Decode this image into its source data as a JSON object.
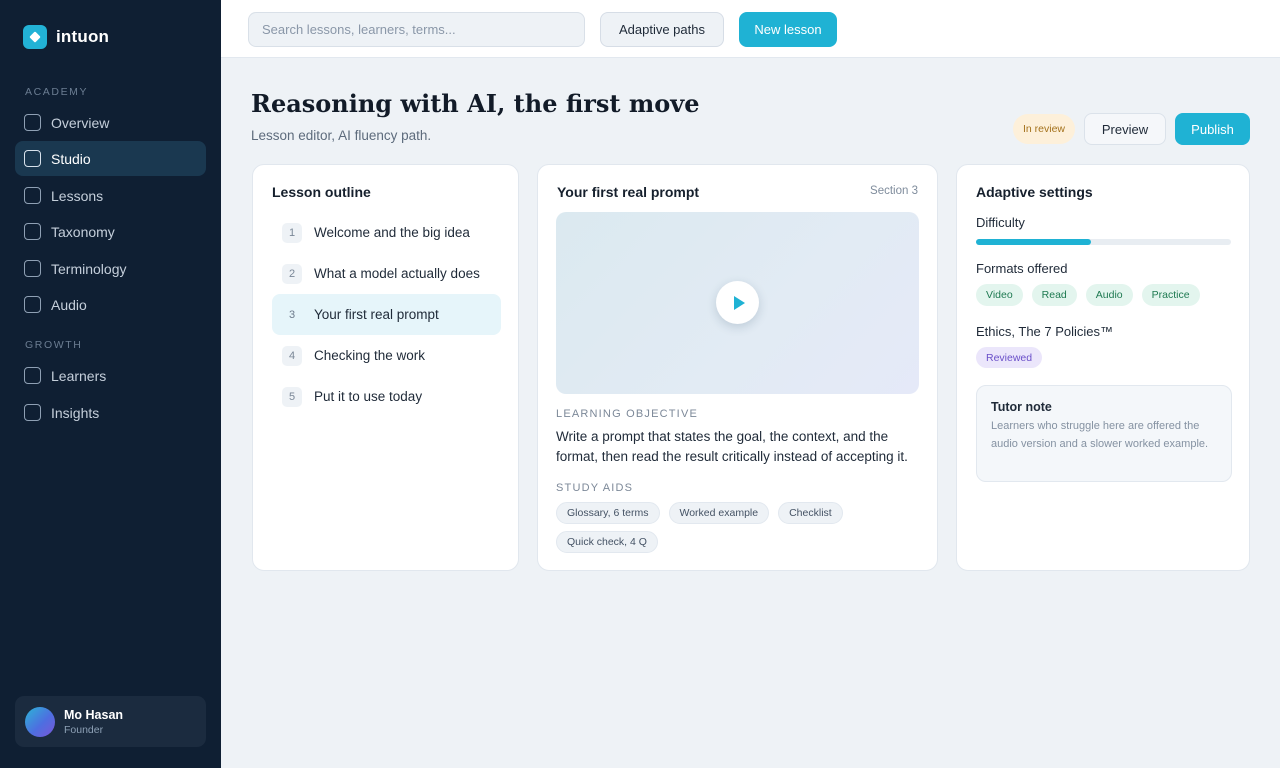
{
  "app": {
    "name": "intuon"
  },
  "sidebar": {
    "sections": [
      {
        "label": "ACADEMY",
        "items": [
          {
            "label": "Overview",
            "active": false
          },
          {
            "label": "Studio",
            "active": true
          },
          {
            "label": "Lessons",
            "active": false
          },
          {
            "label": "Taxonomy",
            "active": false
          },
          {
            "label": "Terminology",
            "active": false
          },
          {
            "label": "Audio",
            "active": false
          }
        ]
      },
      {
        "label": "GROWTH",
        "items": [
          {
            "label": "Learners",
            "active": false
          },
          {
            "label": "Insights",
            "active": false
          }
        ]
      }
    ],
    "user": {
      "name": "Mo Hasan",
      "role": "Founder"
    }
  },
  "topbar": {
    "search_placeholder": "Search lessons, learners, terms...",
    "adaptive_paths_label": "Adaptive paths",
    "new_lesson_label": "New lesson"
  },
  "header": {
    "title": "Reasoning with AI, the first move",
    "subtitle": "Lesson editor, AI fluency path.",
    "status_badge": "In review",
    "preview_label": "Preview",
    "publish_label": "Publish"
  },
  "outline": {
    "title": "Lesson outline",
    "items": [
      {
        "num": "1",
        "label": "Welcome and the big idea",
        "active": false
      },
      {
        "num": "2",
        "label": "What a model actually does",
        "active": false
      },
      {
        "num": "3",
        "label": "Your first real prompt",
        "active": true
      },
      {
        "num": "4",
        "label": "Checking the work",
        "active": false
      },
      {
        "num": "5",
        "label": "Put it to use today",
        "active": false
      }
    ]
  },
  "lesson": {
    "title": "Your first real prompt",
    "section": "Section 3",
    "objective_label": "LEARNING OBJECTIVE",
    "objective": "Write a prompt that states the goal, the context, and the format, then read the result critically instead of accepting it.",
    "study_aids_label": "STUDY AIDS",
    "study_aids": [
      "Glossary, 6 terms",
      "Worked example",
      "Checklist",
      "Quick check, 4 Q"
    ]
  },
  "settings": {
    "title": "Adaptive settings",
    "difficulty_label": "Difficulty",
    "difficulty_value": 0.45,
    "formats_label": "Formats offered",
    "formats": [
      "Video",
      "Read",
      "Audio",
      "Practice"
    ],
    "ethics_label": "Ethics, The 7 Policies™",
    "ethics_status": "Reviewed",
    "tutor_note_title": "Tutor note",
    "tutor_note_body": "Learners who struggle here are offered the audio version and a slower worked example."
  },
  "colors": {
    "accent": "#1fb2d4",
    "sidebar_bg": "#0f1f33",
    "review_badge": "#fdf0da",
    "format_chip": "#e3f5ee",
    "reviewed_chip": "#ebe6fb"
  }
}
